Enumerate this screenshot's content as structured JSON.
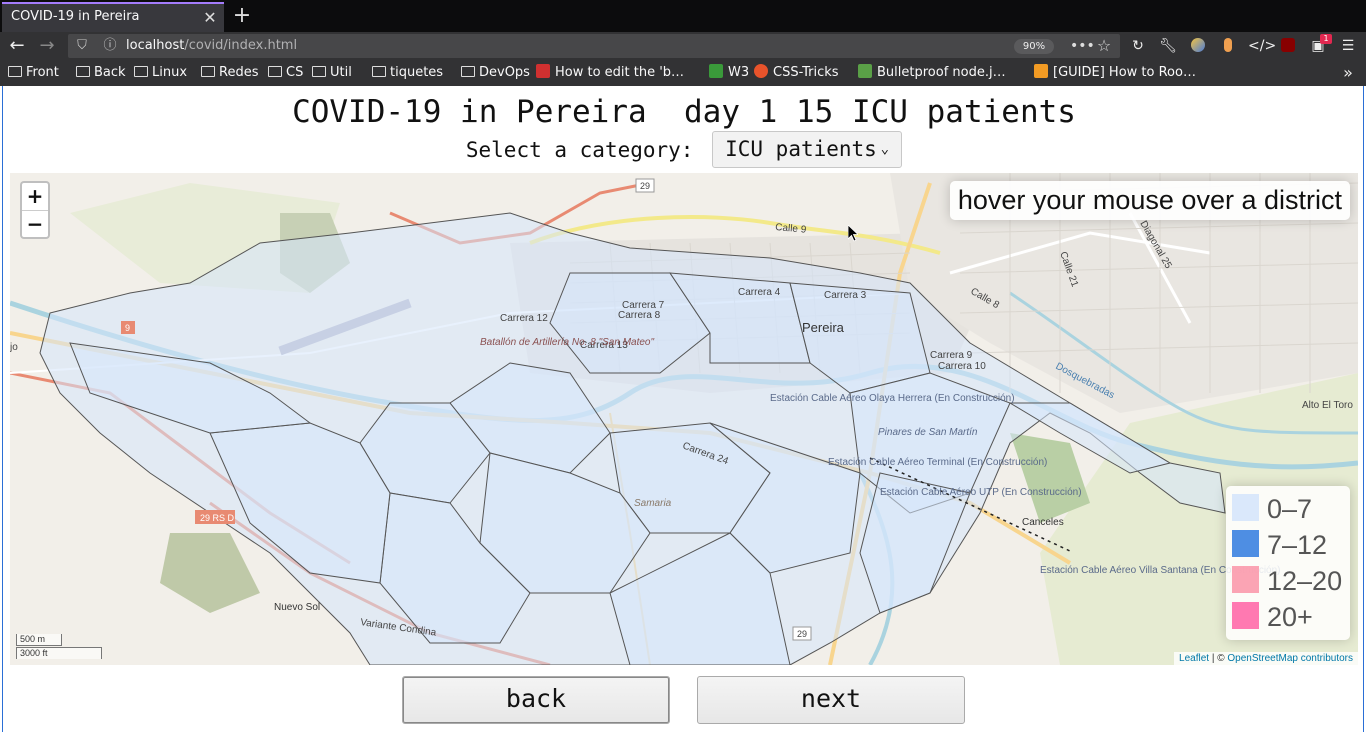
{
  "browser": {
    "tab_title": "COVID-19 in Pereira",
    "url_host": "localhost",
    "url_path": "/covid/index.html",
    "zoom": "90%",
    "extension_badge": "1",
    "bookmarks": [
      {
        "label": "Front",
        "kind": "folder"
      },
      {
        "label": "Back",
        "kind": "folder"
      },
      {
        "label": "Linux",
        "kind": "folder"
      },
      {
        "label": "Redes",
        "kind": "folder"
      },
      {
        "label": "CS",
        "kind": "folder"
      },
      {
        "label": "Util",
        "kind": "folder"
      },
      {
        "label": "tiquetes",
        "kind": "folder"
      },
      {
        "label": "DevOps",
        "kind": "folder"
      },
      {
        "label": "How to edit the 'b…",
        "kind": "link",
        "color": "#d03030"
      },
      {
        "label": "W3",
        "kind": "link",
        "color": "#3a9a3a"
      },
      {
        "label": "CSS-Tricks",
        "kind": "link",
        "color": "#e8532b"
      },
      {
        "label": "Bulletproof node.j…",
        "kind": "link",
        "color": "#5aa047"
      },
      {
        "label": "[GUIDE] How to Roo…",
        "kind": "link",
        "color": "#f29b24"
      }
    ]
  },
  "page": {
    "title": "COVID-19 in Pereira  day 1 15 ICU patients",
    "select_label": "Select a category:",
    "selected_category": "ICU patients",
    "info_text": "hover your mouse over a district",
    "legend": [
      {
        "label": "0–7",
        "color": "#d6e6fb"
      },
      {
        "label": "7–12",
        "color": "#3b82e0"
      },
      {
        "label": "12–20",
        "color": "#fb9aac"
      },
      {
        "label": "20+",
        "color": "#ff6aa8"
      }
    ],
    "scale_metric": "500 m",
    "scale_imperial": "3000 ft",
    "attribution_leaflet": "Leaflet",
    "attribution_sep": "| ©",
    "attribution_osm": "OpenStreetMap contributors",
    "back_label": "back",
    "next_label": "next"
  },
  "map_labels": {
    "city": "Pereira",
    "calle9": "Calle 9",
    "carrera4": "Carrera 4",
    "carrera3": "Carrera 3",
    "carrera7": "Carrera 7",
    "carrera8": "Carrera 8",
    "carrera12": "Carrera 12",
    "carrera13": "Carrera 13",
    "carrera9": "Carrera 9",
    "carrera10": "Carrera 10",
    "carrera24a": "Carrera 24",
    "calle8": "Calle 8",
    "calle21": "Calle 21",
    "diagonal25": "Diagonal 25",
    "dosquebradas": "Dosquebradas",
    "altoeltoro": "Alto El Toro",
    "batallon": "Batallón de Artillería No. 8 \"San Mateo\"",
    "estacion_olaya": "Estación Cable Aéreo Olaya Herrera (En Construcción)",
    "estacion_terminal": "Estación Cable Aéreo Terminal (En Construcción)",
    "estacion_utp": "Estación Cable Aéreo UTP (En Construcción)",
    "pinares": "Pinares de San Martín",
    "canceles": "Canceles",
    "estacion_villa": "Estación Cable Aéreo Villa Santana (En Construcción)",
    "samaria": "Samaria",
    "nuevosol": "Nuevo Sol",
    "variante": "Variante Condina",
    "rs29d": "29 RS D",
    "r29": "29",
    "r9": "9",
    "jo": "jo"
  }
}
